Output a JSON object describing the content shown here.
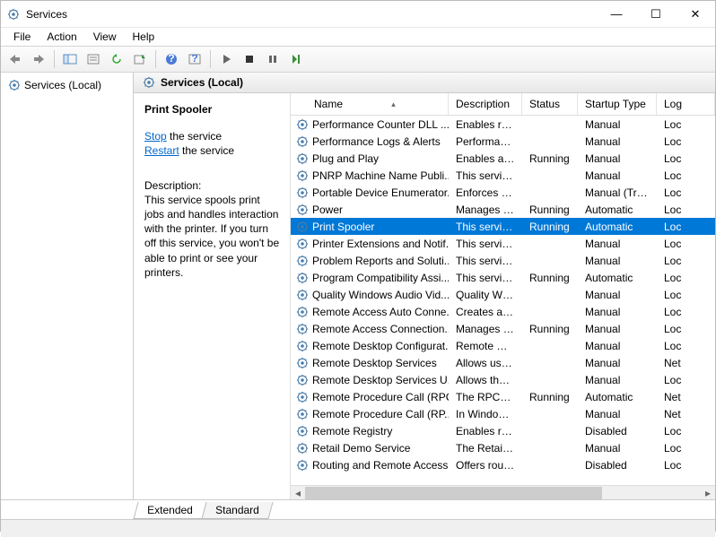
{
  "window": {
    "title": "Services"
  },
  "menu": [
    "File",
    "Action",
    "View",
    "Help"
  ],
  "left_pane": {
    "tree_label": "Services (Local)"
  },
  "right_header": "Services (Local)",
  "detail": {
    "title": "Print Spooler",
    "stop_label": "Stop",
    "stop_suffix": " the service",
    "restart_label": "Restart",
    "restart_suffix": " the service",
    "desc_label": "Description:",
    "desc_text": "This service spools print jobs and handles interaction with the printer. If you turn off this service, you won't be able to print or see your printers."
  },
  "columns": {
    "name": "Name",
    "desc": "Description",
    "status": "Status",
    "startup": "Startup Type",
    "log": "Log"
  },
  "tabs": {
    "extended": "Extended",
    "standard": "Standard"
  },
  "services": [
    {
      "name": "Performance Counter DLL ...",
      "desc": "Enables rem...",
      "status": "",
      "startup": "Manual",
      "log": "Loc"
    },
    {
      "name": "Performance Logs & Alerts",
      "desc": "Performanc...",
      "status": "",
      "startup": "Manual",
      "log": "Loc"
    },
    {
      "name": "Plug and Play",
      "desc": "Enables a c...",
      "status": "Running",
      "startup": "Manual",
      "log": "Loc"
    },
    {
      "name": "PNRP Machine Name Publi...",
      "desc": "This service ...",
      "status": "",
      "startup": "Manual",
      "log": "Loc"
    },
    {
      "name": "Portable Device Enumerator...",
      "desc": "Enforces gr...",
      "status": "",
      "startup": "Manual (Trig...",
      "log": "Loc"
    },
    {
      "name": "Power",
      "desc": "Manages p...",
      "status": "Running",
      "startup": "Automatic",
      "log": "Loc"
    },
    {
      "name": "Print Spooler",
      "desc": "This service ...",
      "status": "Running",
      "startup": "Automatic",
      "log": "Loc",
      "selected": true
    },
    {
      "name": "Printer Extensions and Notif...",
      "desc": "This service ...",
      "status": "",
      "startup": "Manual",
      "log": "Loc"
    },
    {
      "name": "Problem Reports and Soluti...",
      "desc": "This service ...",
      "status": "",
      "startup": "Manual",
      "log": "Loc"
    },
    {
      "name": "Program Compatibility Assi...",
      "desc": "This service ...",
      "status": "Running",
      "startup": "Automatic",
      "log": "Loc"
    },
    {
      "name": "Quality Windows Audio Vid...",
      "desc": "Quality Win...",
      "status": "",
      "startup": "Manual",
      "log": "Loc"
    },
    {
      "name": "Remote Access Auto Conne...",
      "desc": "Creates a co...",
      "status": "",
      "startup": "Manual",
      "log": "Loc"
    },
    {
      "name": "Remote Access Connection...",
      "desc": "Manages di...",
      "status": "Running",
      "startup": "Manual",
      "log": "Loc"
    },
    {
      "name": "Remote Desktop Configurat...",
      "desc": "Remote Des...",
      "status": "",
      "startup": "Manual",
      "log": "Loc"
    },
    {
      "name": "Remote Desktop Services",
      "desc": "Allows user...",
      "status": "",
      "startup": "Manual",
      "log": "Net"
    },
    {
      "name": "Remote Desktop Services U...",
      "desc": "Allows the r...",
      "status": "",
      "startup": "Manual",
      "log": "Loc"
    },
    {
      "name": "Remote Procedure Call (RPC)",
      "desc": "The RPCSS ...",
      "status": "Running",
      "startup": "Automatic",
      "log": "Net"
    },
    {
      "name": "Remote Procedure Call (RP...",
      "desc": "In Windows...",
      "status": "",
      "startup": "Manual",
      "log": "Net"
    },
    {
      "name": "Remote Registry",
      "desc": "Enables rem...",
      "status": "",
      "startup": "Disabled",
      "log": "Loc"
    },
    {
      "name": "Retail Demo Service",
      "desc": "The Retail D...",
      "status": "",
      "startup": "Manual",
      "log": "Loc"
    },
    {
      "name": "Routing and Remote Access",
      "desc": "Offers routi...",
      "status": "",
      "startup": "Disabled",
      "log": "Loc"
    }
  ]
}
